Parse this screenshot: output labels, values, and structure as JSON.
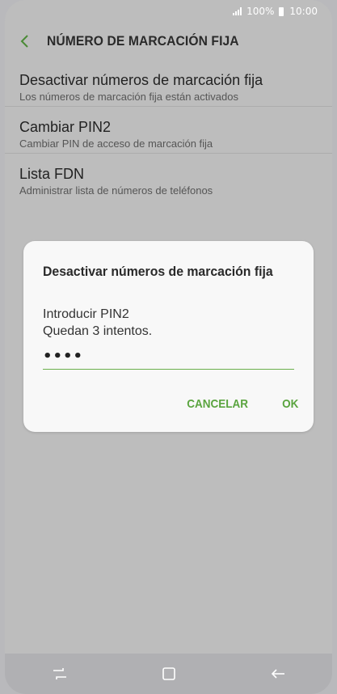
{
  "status_bar": {
    "battery": "100%",
    "time": "10:00"
  },
  "app_bar": {
    "title": "NÚMERO DE MARCACIÓN FIJA"
  },
  "list": {
    "items": [
      {
        "title": "Desactivar números de marcación fija",
        "subtitle": "Los números de marcación fija están activados"
      },
      {
        "title": "Cambiar PIN2",
        "subtitle": "Cambiar PIN de acceso de marcación fija"
      },
      {
        "title": "Lista FDN",
        "subtitle": "Administrar lista de números de teléfonos"
      }
    ]
  },
  "dialog": {
    "title": "Desactivar números de marcación fija",
    "prompt": "Introducir PIN2",
    "attempts": "Quedan 3 intentos.",
    "pin_value": "••••",
    "cancel_label": "CANCELAR",
    "ok_label": "OK"
  },
  "colors": {
    "accent": "#5aa43f",
    "dim_background": "#bdbdbd",
    "dialog_background": "#f8f8f8"
  },
  "icons": {
    "back": "chevron-left-icon",
    "nav_recent": "recent-apps-icon",
    "nav_home": "home-icon",
    "nav_back": "back-arrow-icon"
  }
}
